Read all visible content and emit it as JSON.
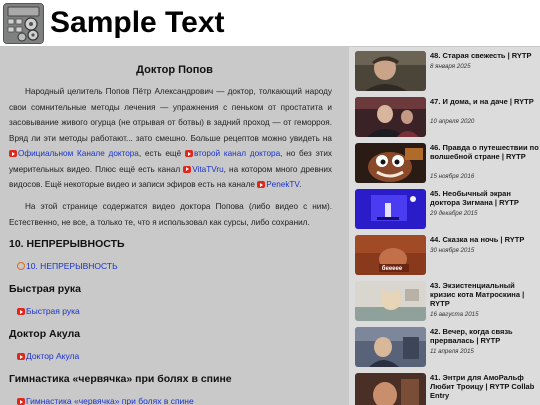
{
  "header": {
    "title": "Sample Text",
    "logo_icon": "calculator-logo-icon"
  },
  "article": {
    "title": "Доктор Попов",
    "p1_t1": "Народный целитель Попов Пётр Александрович — доктор, толкающий народу свои сомнительные методы лечения — упражнения с пеньком от простатита и засовывание живого огурца (не отрывая от ботвы) в задний проход — от геморроя. Вряд ли эти методы работают... зато смешно. Больше рецептов можно увидеть на ",
    "p1_link1": "Официальном Канале доктора",
    "p1_t2": ", есть ещё ",
    "p1_link2": "второй канал доктора",
    "p1_t3": ", но без этих умерительных видео. Плюс ещё есть канал ",
    "p1_link3": "VitaTVru",
    "p1_t4": ", на котором много древних видосов. Ещё некоторые видео и записи эфиров есть на канале ",
    "p1_link4": "PenekTV",
    "p1_t5": ".",
    "p2": "На этой странице содержатся видео доктора Попова (либо видео с ним). Естественно, не все, а только те, что я использовал как сурсы, либо сохранил.",
    "sections": [
      {
        "heading": "10. НЕПРЕРЫВНОСТЬ",
        "link": "10. НЕПРЕРЫВНОСТЬ"
      },
      {
        "heading": "Быстрая рука",
        "link": "Быстрая рука"
      },
      {
        "heading": "Доктор Акула",
        "link": "Доктор Акула"
      },
      {
        "heading": "Гимнастика «червячка» при болях в спине",
        "link": "Гимнастика «червячка» при болях в спине"
      }
    ]
  },
  "sidebar": {
    "videos": [
      {
        "title": "48. Старая свежесть | RYTP",
        "date": "8 января 2025"
      },
      {
        "title": "47. И дома, и на даче | RYTP",
        "date": "10 апреля 2020"
      },
      {
        "title": "46. Правда о путешествии по волшебной стране | RYTP",
        "date": "15 ноября 2016"
      },
      {
        "title": "45. Необычный экран доктора Зигмана | RYTP",
        "date": "29 декабря 2015"
      },
      {
        "title": "44. Сказка на ночь | RYTP",
        "date": "30 ноября 2015"
      },
      {
        "title": "43. Экзистенциальный кризис кота Матроскина | RYTP",
        "date": "16 августа 2015"
      },
      {
        "title": "42. Вечер, когда связь прервалась | RYTP",
        "date": "11 апреля 2015"
      },
      {
        "title": "41. Энтри для АмоРальф Любит Троицу | RYTP Collab Entry",
        "date": ""
      }
    ],
    "thumb4_caption": "беееее"
  },
  "colors": {
    "link": "#1a33cc",
    "youtube": "#e0271a",
    "main_bg": "#c9c9c9",
    "sidebar_bg": "#dcdcdc"
  }
}
